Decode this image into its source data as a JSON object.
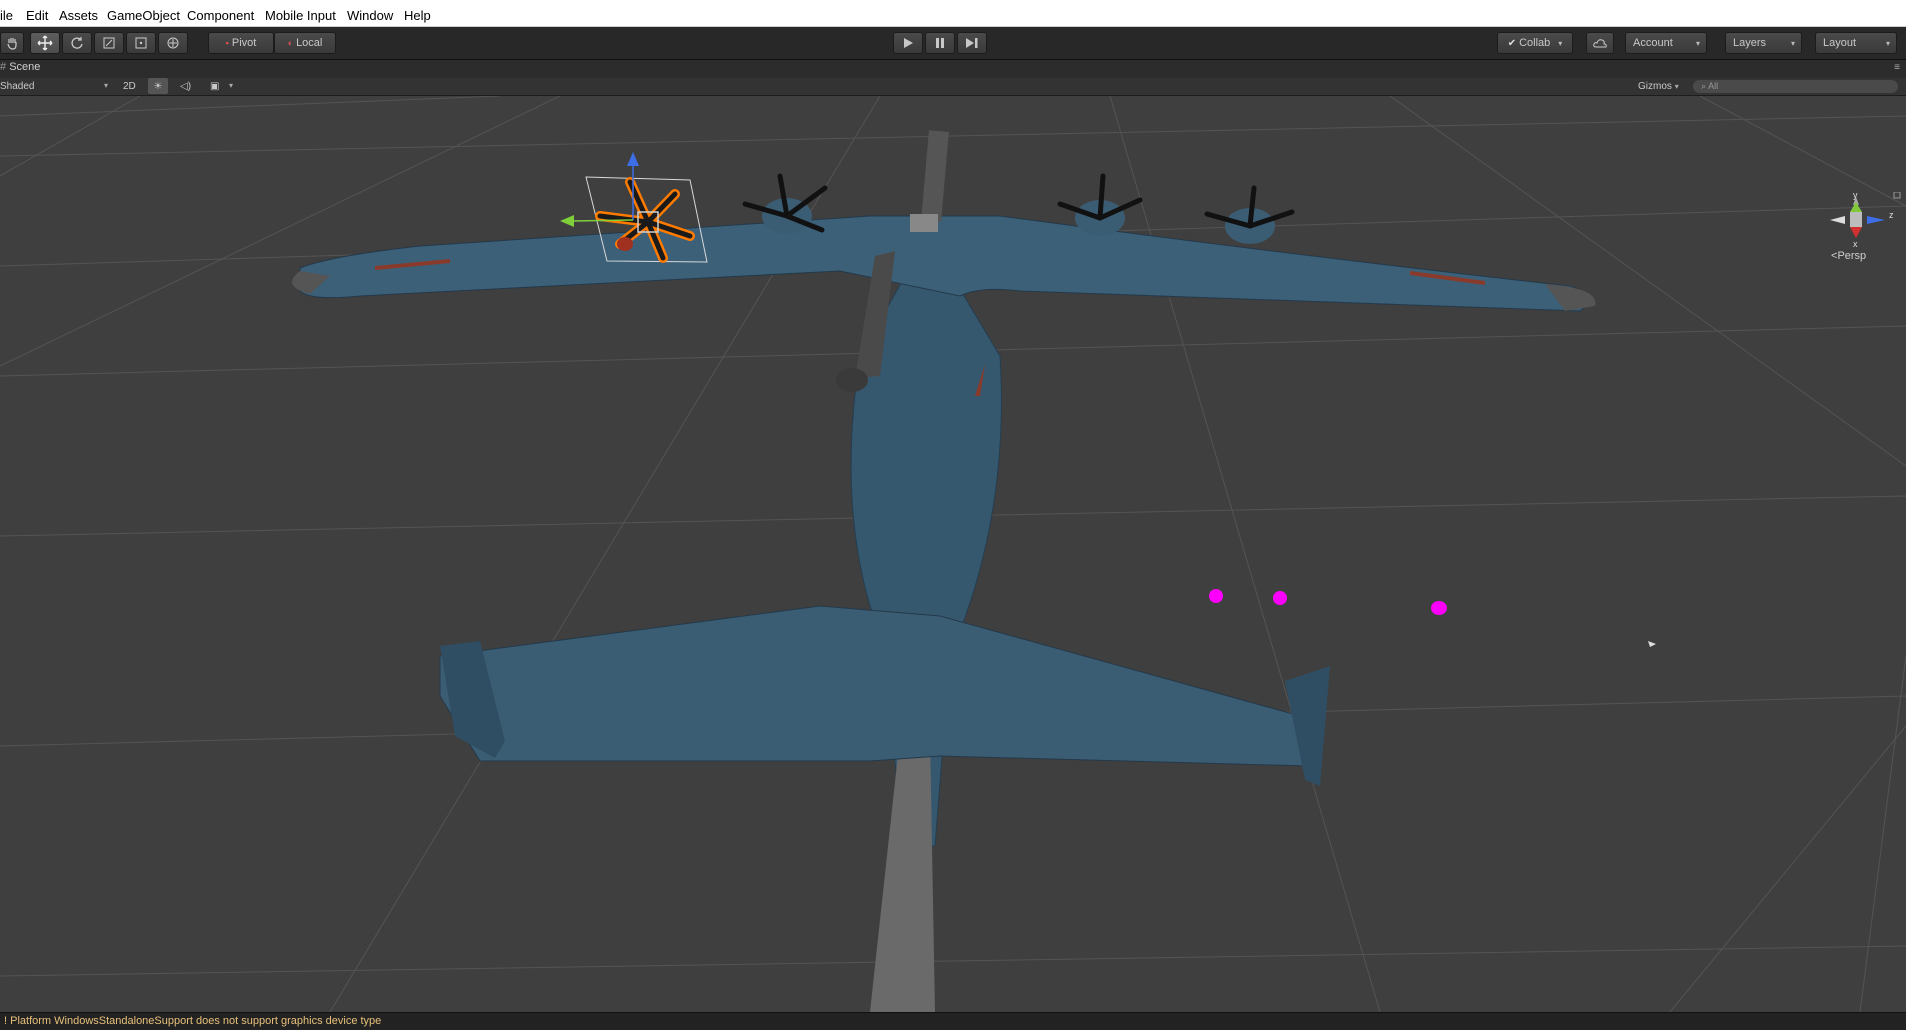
{
  "menubar": {
    "items": [
      "ile",
      "Edit",
      "Assets",
      "GameObject",
      "Component",
      "Mobile Input",
      "Window",
      "Help"
    ]
  },
  "toolbar": {
    "pivot_label": "Pivot",
    "local_label": "Local",
    "collab_label": "Collab",
    "account_label": "Account",
    "layers_label": "Layers",
    "layout_label": "Layout"
  },
  "scene_tab": {
    "label": "Scene"
  },
  "scene_toolbar": {
    "shading_mode": "Shaded",
    "twod_label": "2D",
    "gizmos_label": "Gizmos",
    "search_placeholder": "All"
  },
  "orientation_gizmo": {
    "y_label": "y",
    "z_label": "z",
    "x_label": "x",
    "projection_label": "Persp"
  },
  "console": {
    "message": "Platform WindowsStandaloneSupport does not support graphics device type"
  },
  "colors": {
    "menubar_bg": "#ffffff",
    "toolbar_bg": "#282828",
    "viewport_bg": "#3f3f3f",
    "aircraft_body": "#36586f",
    "selection_outline": "#ff7b00",
    "missing_material": "#ff00ff",
    "console_text": "#e8c07a"
  }
}
